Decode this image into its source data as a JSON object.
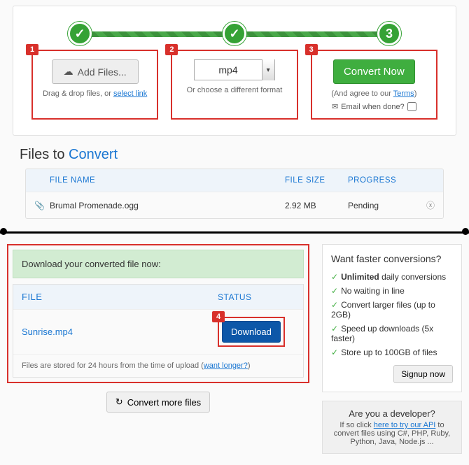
{
  "stepper": {
    "step3_label": "3",
    "badge1": "1",
    "badge2": "2",
    "badge3": "3"
  },
  "step1": {
    "button": "Add Files...",
    "sub_prefix": "Drag & drop files, or ",
    "link": "select link"
  },
  "step2": {
    "value": "mp4",
    "sub": "Or choose a different format"
  },
  "step3": {
    "button": "Convert Now",
    "terms_prefix": "(And agree to our ",
    "terms_link": "Terms",
    "terms_suffix": ")",
    "email_label": "Email when done?"
  },
  "section": {
    "prefix": "Files to ",
    "accent": "Convert"
  },
  "table": {
    "headers": {
      "name": "FILE NAME",
      "size": "FILE SIZE",
      "progress": "PROGRESS"
    },
    "row": {
      "name": "Brumal Promenade.ogg",
      "size": "2.92 MB",
      "progress": "Pending"
    }
  },
  "download": {
    "banner": "Download your converted file now:",
    "headers": {
      "file": "FILE",
      "status": "STATUS"
    },
    "row_file": "Sunrise.mp4",
    "button": "Download",
    "badge": "4",
    "footer_prefix": "Files are stored for 24 hours from the time of upload (",
    "footer_link": "want longer?",
    "footer_suffix": ")"
  },
  "more_button": "Convert more files",
  "promo": {
    "title": "Want faster conversions?",
    "items": [
      {
        "prefix": "",
        "bold": "Unlimited",
        "suffix": " daily conversions"
      },
      {
        "prefix": "No waiting in line",
        "bold": "",
        "suffix": ""
      },
      {
        "prefix": "Convert larger files (up to 2GB)",
        "bold": "",
        "suffix": ""
      },
      {
        "prefix": "Speed up downloads (5x faster)",
        "bold": "",
        "suffix": ""
      },
      {
        "prefix": "Store up to 100GB of files",
        "bold": "",
        "suffix": ""
      }
    ],
    "signup": "Signup now"
  },
  "dev": {
    "title": "Are you a developer?",
    "prefix": "If so click ",
    "link": "here to try our API",
    "suffix": " to convert files using C#, PHP, Ruby, Python, Java, Node.js ..."
  }
}
